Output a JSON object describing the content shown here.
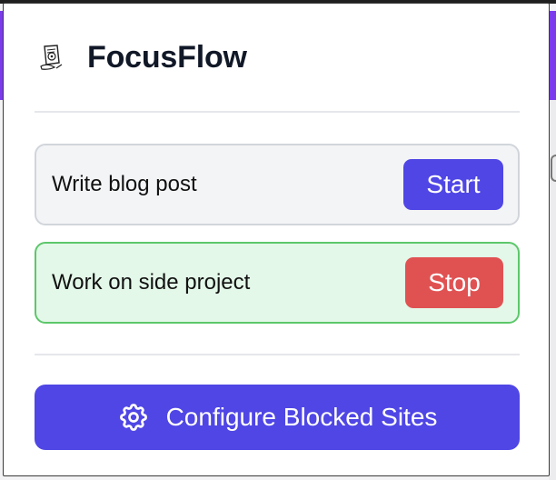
{
  "app": {
    "title": "FocusFlow",
    "logo_icon": "focus-target-sketch-icon"
  },
  "tasks": [
    {
      "label": "Write blog post",
      "action_label": "Start",
      "state": "idle",
      "action_color": "#4f46e5"
    },
    {
      "label": "Work on side project",
      "action_label": "Stop",
      "state": "active",
      "action_color": "#e05252"
    }
  ],
  "configure": {
    "label": "Configure Blocked Sites",
    "icon": "gear-icon",
    "color": "#4f46e5"
  },
  "colors": {
    "accent": "#4f46e5",
    "stop": "#e05252",
    "active_bg": "#e3f8e8",
    "active_border": "#5cc76a",
    "idle_bg": "#f3f4f6"
  }
}
